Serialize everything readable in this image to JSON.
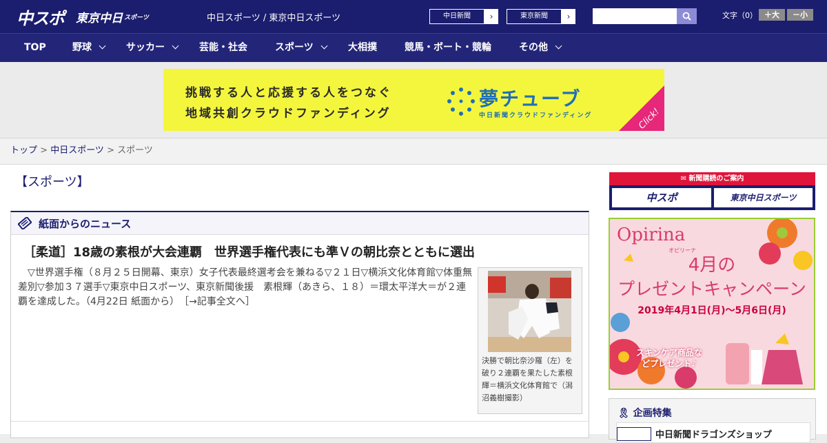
{
  "header": {
    "logo_chuspo": "中スポ",
    "logo_tokyo": "東京中日",
    "logo_tokyo_small": "スポーツ",
    "site_title": "中日スポーツ / 東京中日スポーツ",
    "paper_links": [
      "中日新聞",
      "東京新聞"
    ],
    "search_placeholder": "",
    "fontsize_label": "文字（0）",
    "fontsize_large": "＋大",
    "fontsize_small": "－小"
  },
  "nav": {
    "items": [
      "TOP",
      "野球",
      "サッカー",
      "芸能・社会",
      "スポーツ",
      "大相撲",
      "競馬・ボート・競輪",
      "その他"
    ]
  },
  "banner": {
    "line1": "挑戦する人と応援する人をつなぐ",
    "line2": "地域共創クラウドファンディング",
    "brand": "夢チューブ",
    "brand_sub": "中日新聞クラウドファンディング",
    "click": "Click!"
  },
  "breadcrumb": {
    "home": "トップ",
    "sep1": " > ",
    "parent": "中日スポーツ",
    "sep2": " > ",
    "current": "スポーツ"
  },
  "section_title": "【スポーツ】",
  "news": {
    "box_title": "紙面からのニュース",
    "headline": "［柔道］18歳の素根が大会連覇　世界選手権代表にも準Ｖの朝比奈とともに選出",
    "body": "　▽世界選手権（８月２５日開幕、東京）女子代表最終選考会を兼ねる▽２１日▽横浜文化体育館▽体重無差別▽参加３７選手▽東京中日スポーツ、東京新聞後援　素根輝（あきら、１８）＝環太平洋大＝が２連覇を達成した。（4月22日 紙面から）",
    "more_link": "［→記事全文へ］",
    "photo_caption": "決勝で朝比奈沙羅（左）を破り２連覇を果たした素根輝＝横浜文化体育館で（潟沼義樹撮影）"
  },
  "sidebar": {
    "subscription_head": "新聞購読のご案内",
    "sub_buttons": [
      "中スポ",
      "東京中日スポーツ"
    ],
    "ad": {
      "logo": "Opirina",
      "logo_sub": "オピリーナ",
      "line1": "4月の",
      "line2": "プレゼントキャンペーン",
      "line3": "2019年4月1日(月)～5月6日(月)",
      "line4": "スキンケア商品などプレゼント♪"
    },
    "kikaku_head": "企画特集",
    "kikaku_item": "中日新聞ドラゴンズショップ"
  },
  "colors": {
    "navy": "#1b1d6e",
    "banner_yellow": "#f4f63d",
    "accent_red": "#e0153a"
  }
}
